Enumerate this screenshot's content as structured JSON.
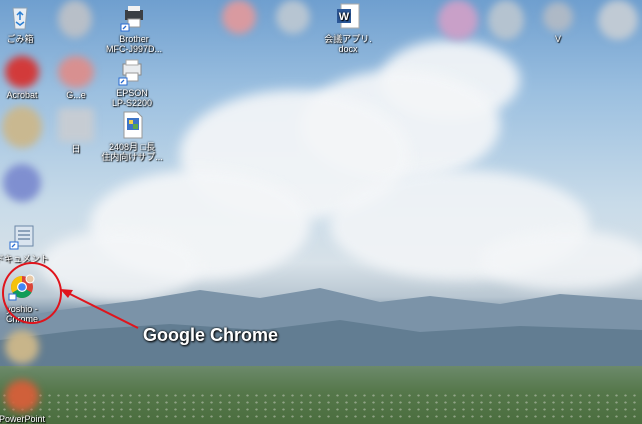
{
  "desktop": {
    "icons": [
      {
        "label": "ごみ箱",
        "icon": "recycle-bin-icon"
      },
      {
        "label": "Brother\nMFC-J997D...",
        "icon": "printer-icon"
      },
      {
        "label": "会議アプリ.\ndocx",
        "icon": "word-document-icon"
      },
      {
        "label": "V",
        "icon": "blurred-app-icon"
      },
      {
        "label": "Acrobat",
        "icon": "acrobat-icon"
      },
      {
        "label": "G...e",
        "icon": "blurred-app-icon"
      },
      {
        "label": "EPSON\nLP-S2200",
        "icon": "printer-icon"
      },
      {
        "label": "日",
        "icon": "blurred-app-icon"
      },
      {
        "label": "2408月 □長\n住内向けサプ...",
        "icon": "image-file-icon"
      },
      {
        "label": "",
        "icon": "blurred-app-icon"
      },
      {
        "label": "ドキュメント",
        "icon": "documents-shortcut-icon"
      },
      {
        "label": "yoshio -\nChrome",
        "icon": "chrome-icon"
      },
      {
        "label": "",
        "icon": "blurred-app-icon"
      },
      {
        "label": "PowerPoint",
        "icon": "powerpoint-icon"
      }
    ]
  },
  "annotation": {
    "text": "Google Chrome",
    "color": "#e0141c"
  }
}
